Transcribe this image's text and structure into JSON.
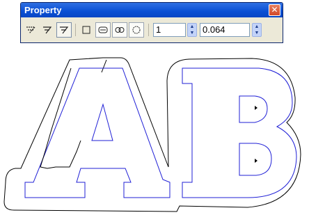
{
  "palette": {
    "title": "Property",
    "close_glyph": "✕",
    "tools": [
      {
        "name": "outline-offset-dashed-icon"
      },
      {
        "name": "outline-offset-icon"
      },
      {
        "name": "outline-offset-active-icon",
        "pressed": true
      },
      {
        "name": "square-corner-icon"
      },
      {
        "name": "rounded-corner-icon"
      },
      {
        "name": "loop-corner-icon"
      },
      {
        "name": "round-corner-icon"
      }
    ],
    "count_value": "1",
    "offset_value": "0.064",
    "spin_up_glyph": "▲",
    "spin_down_glyph": "▼"
  },
  "canvas": {
    "letters": "AB",
    "outline_color": "#000000",
    "inner_color": "#1f1fd6"
  }
}
